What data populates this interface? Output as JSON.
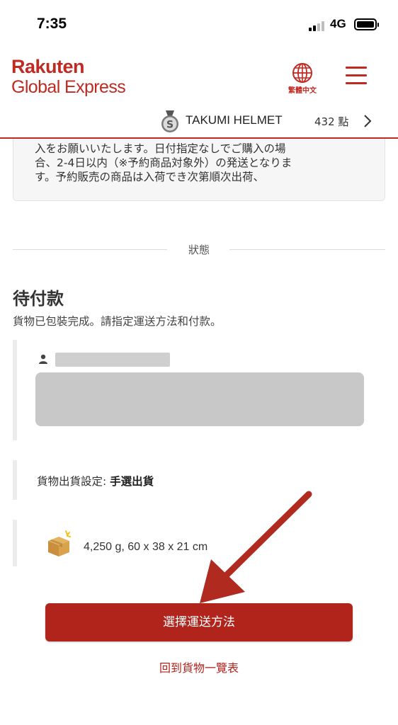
{
  "status_bar": {
    "time": "7:35",
    "network": "4G"
  },
  "header": {
    "logo_top": "Rakuten",
    "logo_bottom": "Global Express",
    "language_label": "繁體中文",
    "user_name": "TAKUMI HELMET",
    "points": "432 點"
  },
  "notice": {
    "lines": [
      "入をお願いいたします。日付指定なしでご購入の場",
      "合、2-4日以内（※予約商品対象外）の発送となりま",
      "す。予約販売の商品は入荷でき次第順次出荷、"
    ]
  },
  "status_section": {
    "divider_label": "狀態",
    "title": "待付款",
    "description": "貨物已包裝完成。請指定運送方法和付款。"
  },
  "shipping_setting": {
    "label": "貨物出貨設定: ",
    "value": "手選出貨"
  },
  "package": {
    "details": "4,250 g, 60 x 38 x 21 cm"
  },
  "actions": {
    "select_shipping": "選擇運送方法",
    "back_to_list": "回到貨物一覽表"
  },
  "colors": {
    "brand_red": "#bf2a23",
    "button_red": "#b1241c",
    "arrow_red": "#b02a20"
  }
}
